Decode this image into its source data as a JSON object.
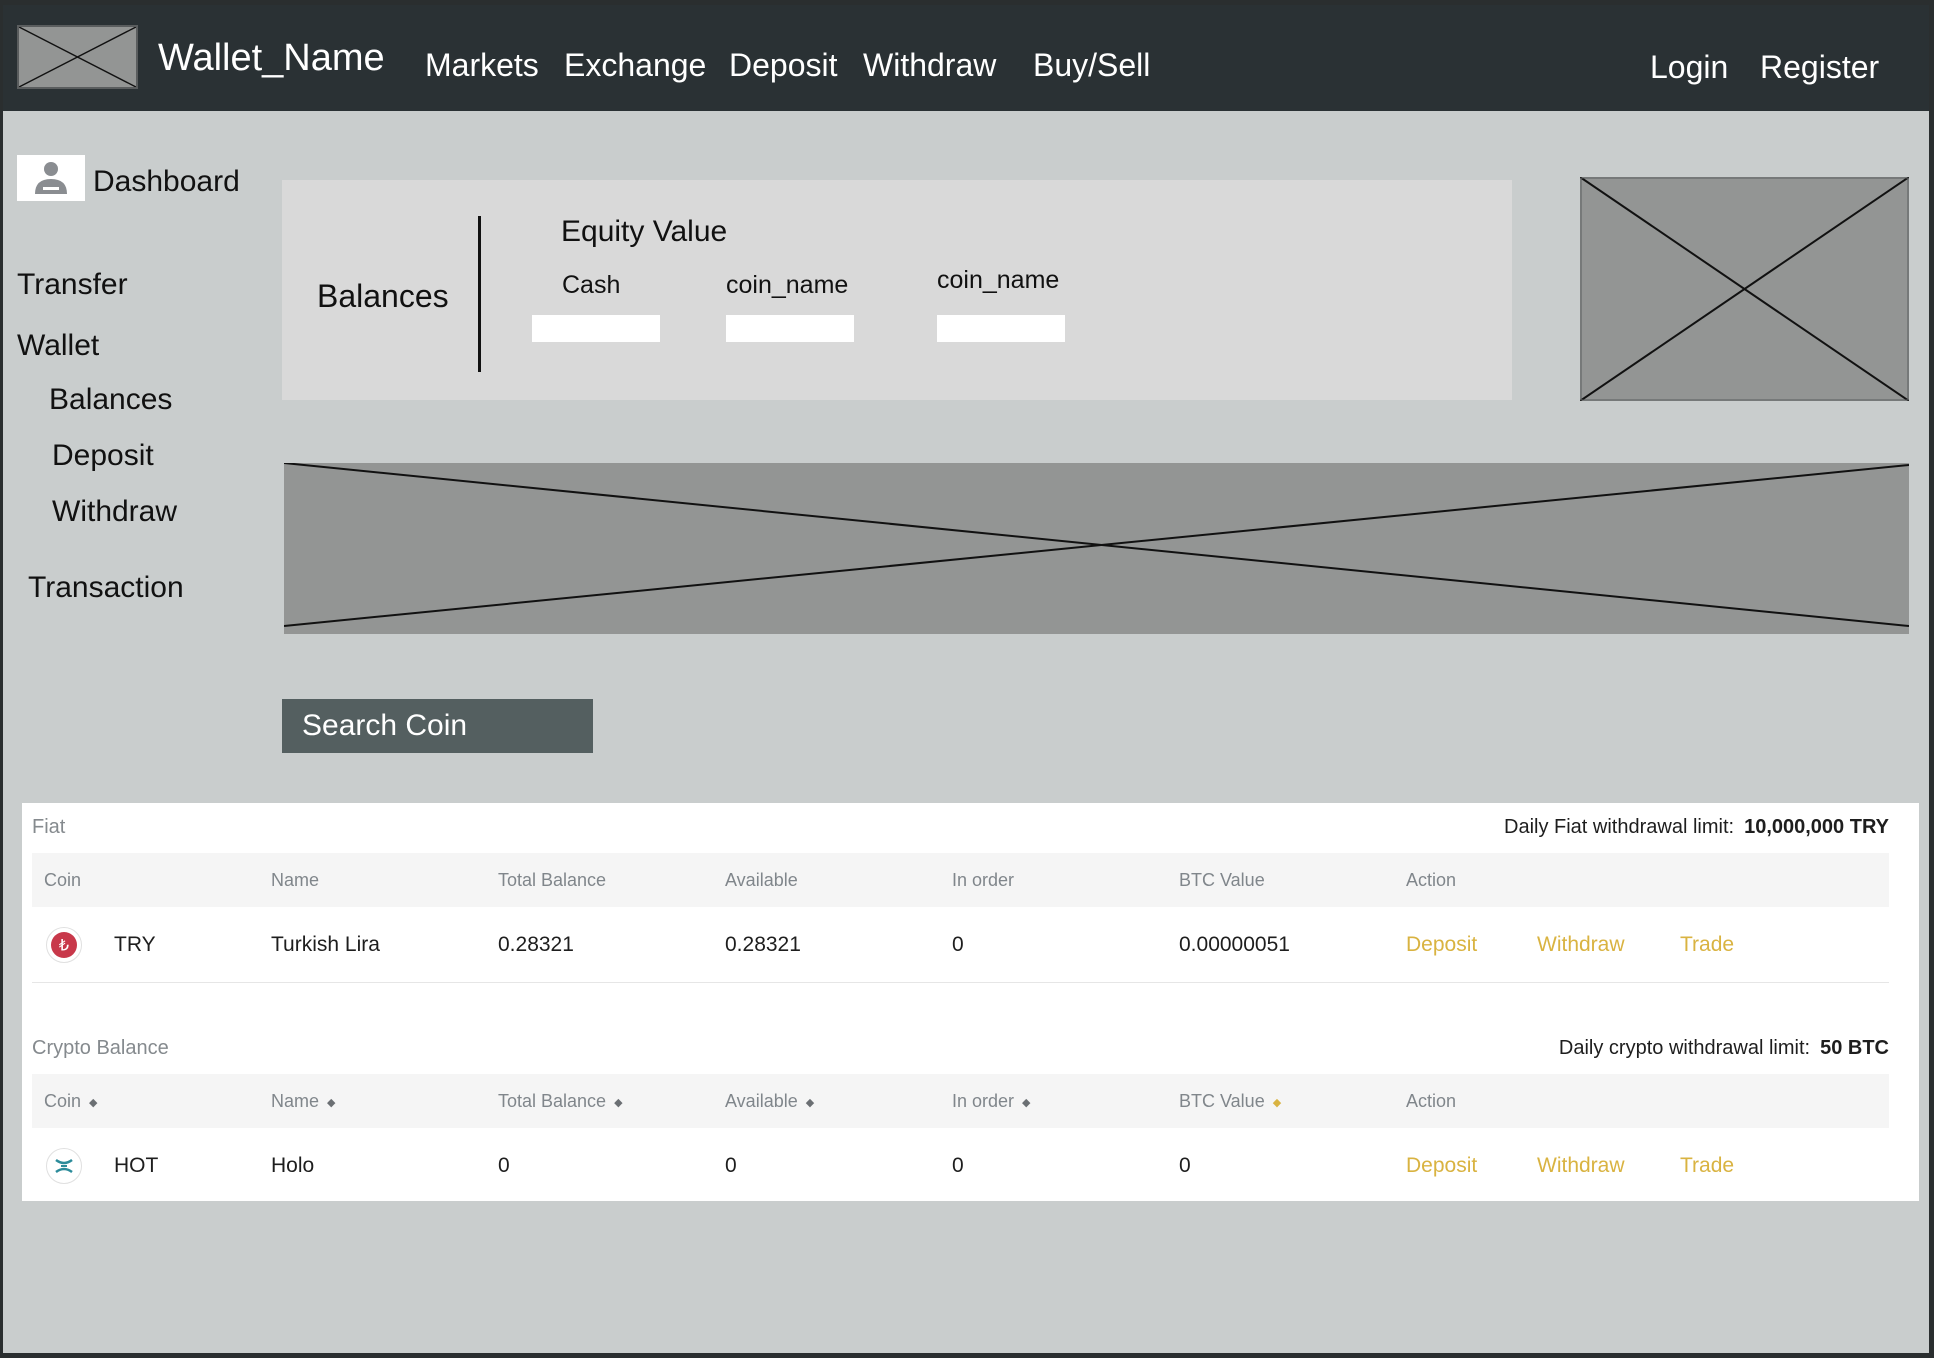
{
  "header": {
    "brand": "Wallet_Name",
    "nav": [
      "Markets",
      "Exchange",
      "Deposit",
      "Withdraw",
      "Buy/Sell"
    ],
    "login": "Login",
    "register": "Register"
  },
  "sidebar": {
    "dashboard": "Dashboard",
    "transfer": "Transfer",
    "wallet": "Wallet",
    "wallet_items": [
      "Balances",
      "Deposit",
      "Withdraw"
    ],
    "transaction": "Transaction"
  },
  "balances_panel": {
    "title": "Balances",
    "equity_title": "Equity Value",
    "columns": [
      "Cash",
      "coin_name",
      "coin_name"
    ]
  },
  "search": {
    "label": "Search Coin"
  },
  "fiat": {
    "title": "Fiat",
    "limit_label": "Daily Fiat withdrawal limit:",
    "limit_value": "10,000,000 TRY",
    "headers": [
      "Coin",
      "Name",
      "Total Balance",
      "Available",
      "In order",
      "BTC Value",
      "Action"
    ],
    "rows": [
      {
        "coin": "TRY",
        "name": "Turkish Lira",
        "total": "0.28321",
        "available": "0.28321",
        "in_order": "0",
        "btc_value": "0.00000051",
        "actions": [
          "Deposit",
          "Withdraw",
          "Trade"
        ],
        "icon": "lira-icon"
      }
    ]
  },
  "crypto": {
    "title": "Crypto Balance",
    "limit_label": "Daily crypto withdrawal limit:",
    "limit_value": "50 BTC",
    "headers": [
      "Coin",
      "Name",
      "Total Balance",
      "Available",
      "In order",
      "BTC Value",
      "Action"
    ],
    "sorted_column": "BTC Value",
    "rows": [
      {
        "coin": "HOT",
        "name": "Holo",
        "total": "0",
        "available": "0",
        "in_order": "0",
        "btc_value": "0",
        "actions": [
          "Deposit",
          "Withdraw",
          "Trade"
        ],
        "icon": "holo-icon"
      }
    ]
  },
  "colors": {
    "topbar": "#2a3134",
    "background": "#c9cdcd",
    "accent_action": "#d9b341",
    "search_button": "#545f60",
    "lira_icon": "#c8384a",
    "holo_icon": "#2b8b9a"
  }
}
